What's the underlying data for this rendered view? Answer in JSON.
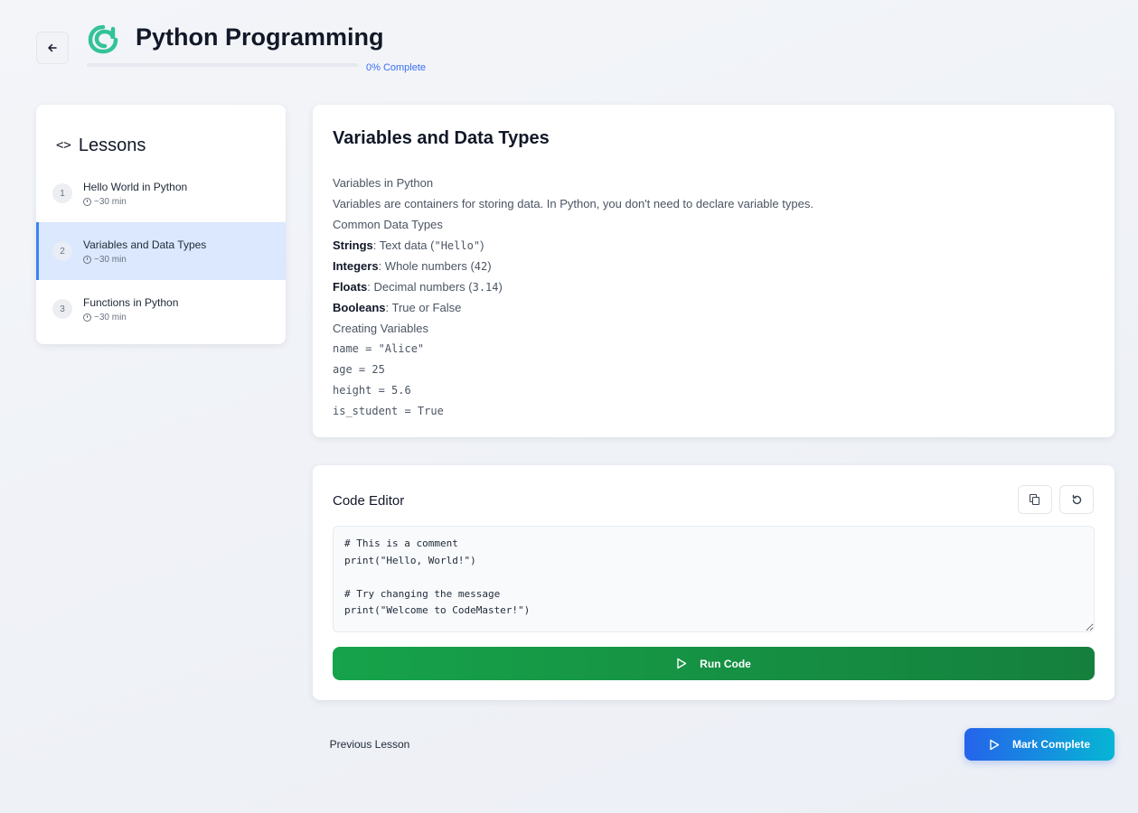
{
  "header": {
    "back_icon": "arrow-left-icon",
    "logo_icon": "app-logo",
    "course_title": "Python Programming",
    "progress_percent": 0,
    "progress_label": "0% Complete"
  },
  "sidebar": {
    "title": "Lessons",
    "title_icon": "code-icon",
    "lessons": [
      {
        "number": "1",
        "title": "Hello World in Python",
        "duration": "~30 min",
        "active": false
      },
      {
        "number": "2",
        "title": "Variables and Data Types",
        "duration": "~30 min",
        "active": true
      },
      {
        "number": "3",
        "title": "Functions in Python",
        "duration": "~30 min",
        "active": false
      }
    ]
  },
  "lesson": {
    "title": "Variables and Data Types",
    "heading_variables": "Variables in Python",
    "intro": "Variables are containers for storing data. In Python, you don't need to declare variable types.",
    "heading_types": "Common Data Types",
    "types": [
      {
        "name": "Strings",
        "desc_prefix": ": Text data (",
        "code": "\"Hello\"",
        "desc_suffix": ")"
      },
      {
        "name": "Integers",
        "desc_prefix": ": Whole numbers (",
        "code": "42",
        "desc_suffix": ")"
      },
      {
        "name": "Floats",
        "desc_prefix": ": Decimal numbers (",
        "code": "3.14",
        "desc_suffix": ")"
      },
      {
        "name": "Booleans",
        "desc_prefix": ": True or False",
        "code": "",
        "desc_suffix": ""
      }
    ],
    "heading_creating": "Creating Variables",
    "code_lines": [
      "name = \"Alice\"",
      "age = 25",
      "height = 5.6",
      "is_student = True"
    ]
  },
  "editor": {
    "title": "Code Editor",
    "copy_icon": "copy-icon",
    "reset_icon": "reset-icon",
    "code": "# This is a comment\nprint(\"Hello, World!\")\n\n# Try changing the message\nprint(\"Welcome to CodeMaster!\")",
    "run_label": "Run Code"
  },
  "footer": {
    "prev_label": "Previous Lesson",
    "complete_label": "Mark Complete"
  },
  "colors": {
    "accent": "#3b82f6",
    "run": "#16a34a",
    "complete_start": "#2563eb",
    "complete_end": "#06b6d4",
    "logo": "#34c29a"
  }
}
